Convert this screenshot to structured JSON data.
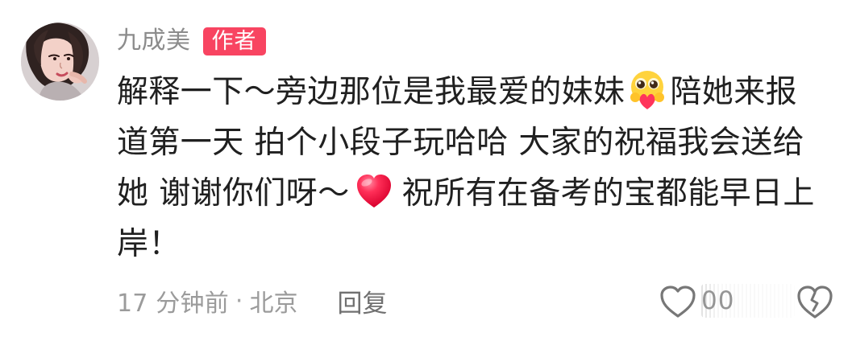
{
  "comment": {
    "username": "九成美",
    "badge": "作者",
    "body": {
      "line1_before_emoji": "解释一下～旁边那位是我最爱的妹妹",
      "line1_after_emoji": "陪她来报",
      "line2": "道第一天 拍个小段子玩哈哈 大家的祝福我会送给",
      "line3_before_emoji": "她 谢谢你们呀～",
      "line3_after_emoji": "祝所有在备考的宝都能早日上",
      "line4": "岸！"
    },
    "meta": {
      "time": "17 分钟前",
      "separator": "·",
      "location": "北京",
      "reply": "回复"
    },
    "actions": {
      "like_count_partial": "00"
    },
    "icons": {
      "avatar": "user-avatar",
      "hug_emoji": "smiling-face-with-open-hands-emoji",
      "heart_emoji": "red-heart-emoji",
      "like": "heart-outline-icon",
      "dislike": "broken-heart-outline-icon"
    },
    "colors": {
      "badge": "#f84461",
      "username": "#8c8c8c",
      "body_text": "#202020",
      "meta_text": "#9b9b9b"
    }
  }
}
